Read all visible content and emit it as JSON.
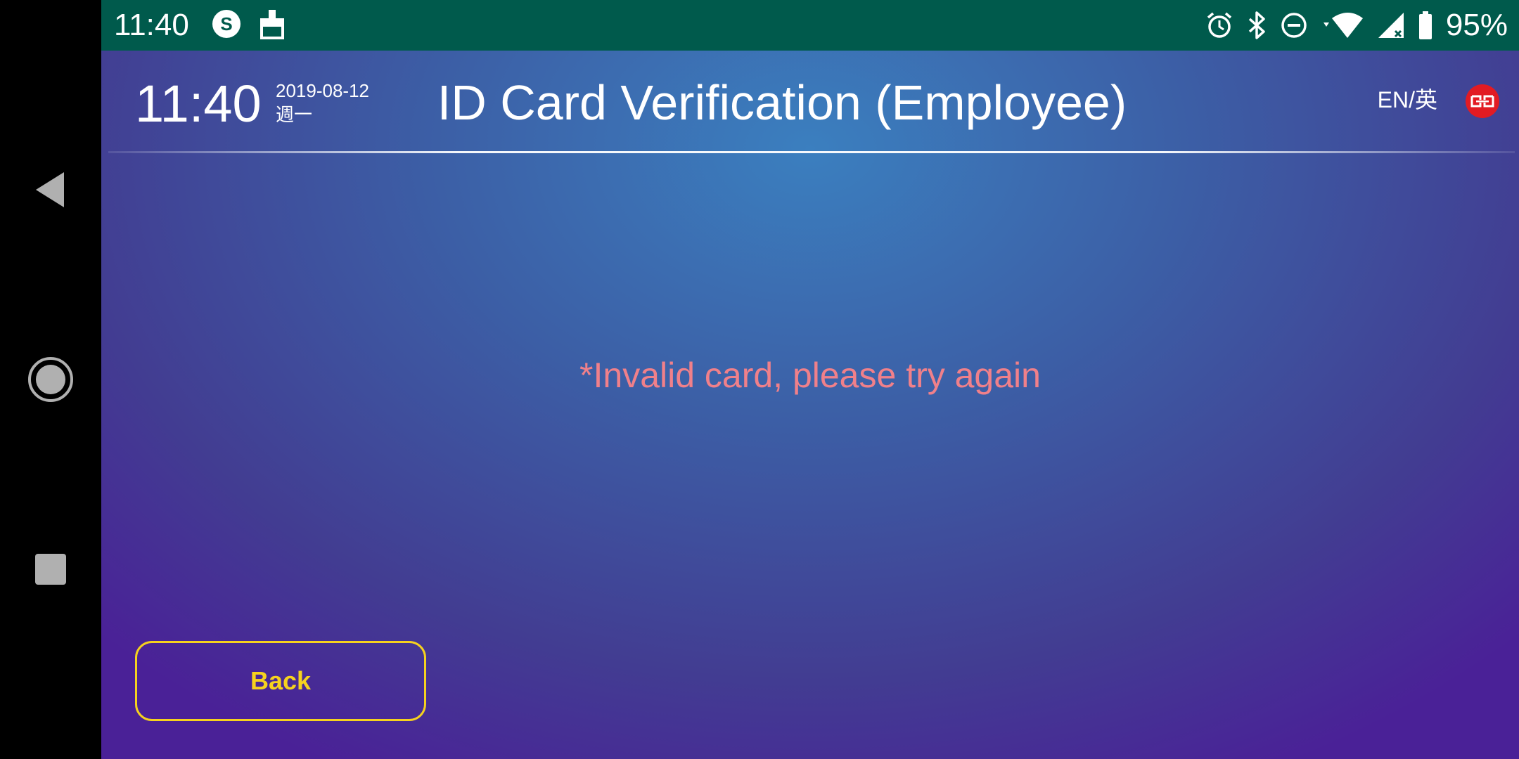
{
  "status_bar": {
    "time": "11:40",
    "battery_percent": "95%",
    "left_icons": [
      "sweatcoin-icon",
      "cleaner-icon"
    ],
    "right_icons": [
      "alarm-icon",
      "bluetooth-icon",
      "do-not-disturb-icon",
      "wifi-icon",
      "signal-icon",
      "battery-icon"
    ],
    "background": "#005a4c"
  },
  "header": {
    "time": "11:40",
    "date": "2019-08-12",
    "weekday": "週一",
    "title": "ID Card Verification (Employee)",
    "language_toggle": "EN/英",
    "logo_icon": "brand-logo-icon"
  },
  "main": {
    "error_message": "*Invalid card, please try again",
    "error_color": "#f0808a"
  },
  "footer": {
    "back_label": "Back",
    "back_color": "#f6d21e"
  },
  "nav_bar": {
    "icons": [
      "back-triangle-icon",
      "home-circle-icon",
      "recents-square-icon"
    ]
  }
}
